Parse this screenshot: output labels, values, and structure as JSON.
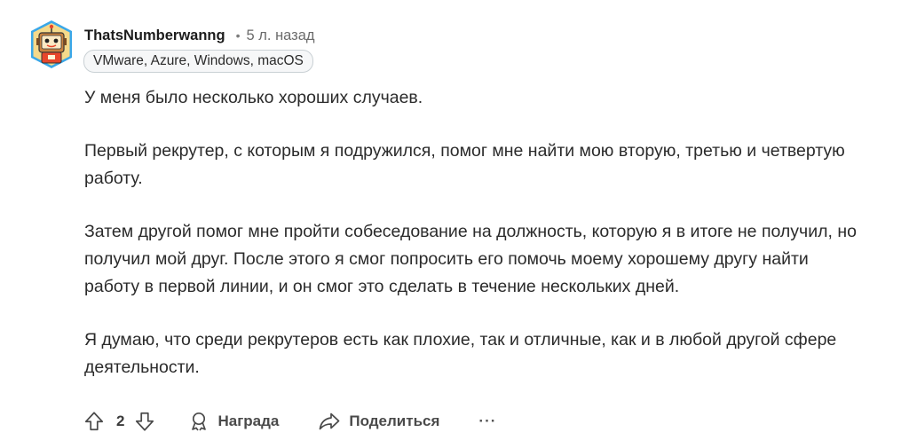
{
  "comment": {
    "author": "ThatsNumberwanng",
    "separator": "•",
    "timestamp": "5 л. назад",
    "flair": "VMware, Azure, Windows, macOS",
    "paragraphs": [
      "У меня было несколько хороших случаев.",
      "Первый рекрутер, с которым я подружился, помог мне найти мою вторую, третью и четвертую работу.",
      "Затем другой помог мне пройти собеседование на должность, которую я в итоге не получил, но получил мой друг. После этого я смог попросить его помочь моему хорошему другу найти работу в первой линии, и он смог это сделать в течение нескольких дней.",
      "Я думаю, что среди рекрутеров есть как плохие, так и отличные, как и в любой другой сфере деятельности."
    ]
  },
  "actions": {
    "vote_count": "2",
    "award_label": "Награда",
    "share_label": "Поделиться",
    "more_label": "···"
  },
  "icons": {
    "upvote": "upvote-arrow-icon",
    "downvote": "downvote-arrow-icon",
    "award": "award-medal-icon",
    "share": "share-arrow-icon",
    "more": "more-dots-icon"
  },
  "colors": {
    "text": "#2b2b2b",
    "muted": "#6b6b6b",
    "flair_border": "#c9d0d4",
    "avatar_accent": "#e8462b"
  }
}
